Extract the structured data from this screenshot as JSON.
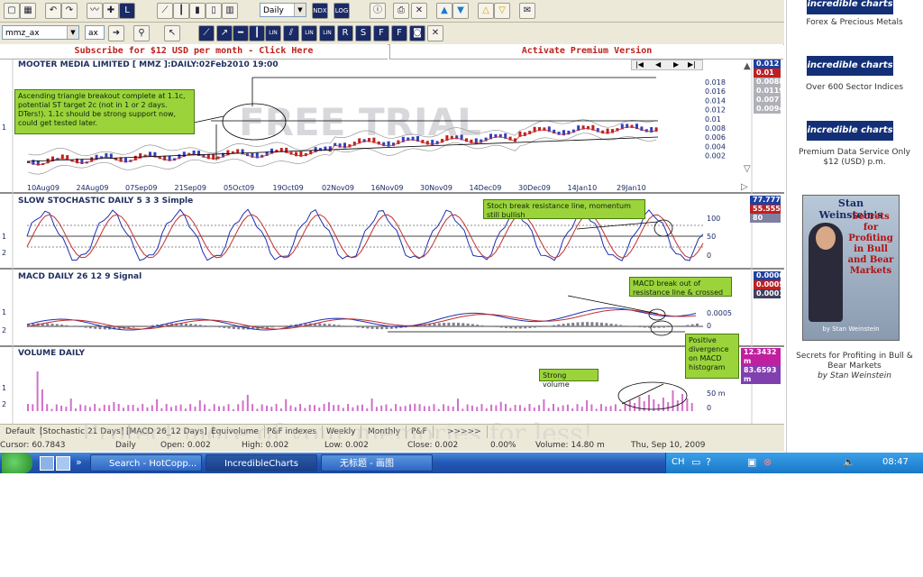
{
  "toolbar1": {
    "period": "Daily",
    "buttons": [
      "NDX",
      "LOG"
    ]
  },
  "toolbar2": {
    "symbol": "mmz_ax",
    "exchange": "ax",
    "tools": [
      "LIN",
      "LIN",
      "LIN",
      "R",
      "S",
      "F",
      "F"
    ]
  },
  "promo": {
    "left": "Subscribe for $12 USD per month - Click Here",
    "right": "Activate Premium Version"
  },
  "price_panel": {
    "title": "MOOTER MEDIA LIMITED [ MMZ ]:DAILY:02Feb2010 19:00",
    "watermark": "FREE TRIAL",
    "y_ticks": [
      "0.018",
      "0.016",
      "0.014",
      "0.012",
      "0.01",
      "0.008",
      "0.006",
      "0.004",
      "0.002"
    ],
    "x_ticks": [
      "10Aug09",
      "24Aug09",
      "07Sep09",
      "21Sep09",
      "05Oct09",
      "19Oct09",
      "02Nov09",
      "16Nov09",
      "30Nov09",
      "14Dec09",
      "30Dec09",
      "14Jan10",
      "29Jan10"
    ],
    "values": [
      "0.012",
      "0.01",
      "0.0088",
      "0.0119",
      "0.007",
      "0.0094"
    ],
    "left_label": "1",
    "note": "Ascending triangle breakout complete at 1.1c, potential ST target 2c (not in 1 or 2 days. DTers!). 1.1c should be strong support now, could get tested later."
  },
  "stoch_panel": {
    "title": "SLOW STOCHASTIC DAILY 5 3 3 Simple",
    "y_ticks": [
      "100",
      "50",
      "0"
    ],
    "values": [
      "77.7778",
      "55.5556",
      "80"
    ],
    "left_labels": [
      "1",
      "2"
    ],
    "note": "Stoch break resistance line, momentum still bullish"
  },
  "macd_panel": {
    "title": "MACD DAILY 26 12 9 Signal",
    "y_ticks": [
      "0.0005",
      "0"
    ],
    "values": [
      "0.0006",
      "0.0005",
      "0.0001"
    ],
    "left_labels": [
      "1",
      "2"
    ],
    "note1": "MACD break out of resistance line & crossed",
    "note2": "Positive divergence on MACD histogram"
  },
  "volume_panel": {
    "title": "VOLUME DAILY",
    "y_ticks": [
      "50 m",
      "0"
    ],
    "values": [
      "12.3432 m",
      "83.6593 m"
    ],
    "left_labels": [
      "1",
      "2"
    ],
    "note": "Strong volume"
  },
  "tabs": [
    "Default",
    "[Stochastic 21 Days]",
    "[MACD 26_12 Days]",
    "Equivolume",
    "P&F indexes",
    "Weekly",
    "Monthly",
    "P&F",
    ">>>>>"
  ],
  "status": {
    "cursor": "Cursor: 60.7843",
    "period": "Daily",
    "open": "Open: 0.002",
    "high": "High: 0.002",
    "low": "Low: 0.002",
    "close": "Close: 0.002",
    "change": "0.00%",
    "volume": "Volume: 14.80 m",
    "date": "Thu, Sep 10, 2009"
  },
  "watermark_bottom": "Protect more of your memories for less!",
  "taskbar": {
    "items": [
      "Search - HotCopp...",
      "IncredibleCharts",
      "无标题 - 画图"
    ],
    "lang": "CH",
    "time": "08:47"
  },
  "sidebar": {
    "brand": "incredible charts",
    "ad1": "Forex & Precious Metals",
    "ad2": "Over 600 Sector Indices",
    "ad3": "Premium Data Service Only $12 (USD) p.m.",
    "book_title": "Stan Weinstein's",
    "book_sub": "Secrets for Profiting in Bull and Bear Markets",
    "book_author": "by Stan Weinstein",
    "ad4": "Secrets for Profiting in Bull & Bear Markets",
    "ad4_author": "by Stan Weinstein"
  },
  "colors": {
    "bull": "#3040c0",
    "bear": "#c02020",
    "panel_value_bg": "#2040a0",
    "note_bg": "#9bd43a"
  }
}
